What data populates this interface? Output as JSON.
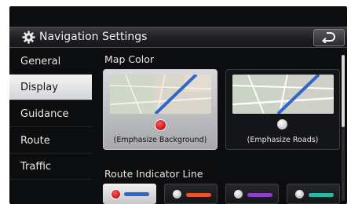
{
  "header": {
    "title": "Navigation Settings",
    "settings_icon": "gear-icon",
    "back_icon": "back-arrow-icon"
  },
  "sidebar": {
    "items": [
      {
        "label": "General",
        "active": false
      },
      {
        "label": "Display",
        "active": true
      },
      {
        "label": "Guidance",
        "active": false
      },
      {
        "label": "Route",
        "active": false
      },
      {
        "label": "Traffic",
        "active": false
      }
    ]
  },
  "main": {
    "map_color": {
      "label": "Map Color",
      "options": [
        {
          "label": "(Emphasize Background)",
          "selected": true
        },
        {
          "label": "(Emphasize Roads)",
          "selected": false
        }
      ]
    },
    "route_line": {
      "label": "Route Indicator Line",
      "options": [
        {
          "color": "#2f66c9",
          "selected": true
        },
        {
          "color": "#e8552a",
          "selected": false
        },
        {
          "color": "#8e3fc8",
          "selected": false
        },
        {
          "color": "#27b8a6",
          "selected": false
        }
      ]
    }
  },
  "colors": {
    "selected_radio": "#d6202a",
    "screen_background": "#0c0d0f"
  }
}
